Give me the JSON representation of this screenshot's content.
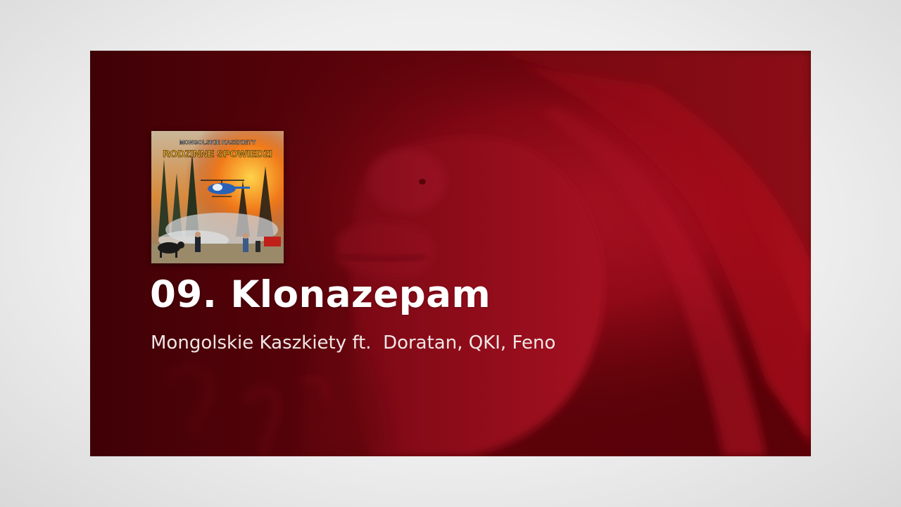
{
  "video": {
    "track_title": "09. Klonazepam",
    "track_artists": "Mongolskie Kaszkiety ft.  Doratan, QKI, Feno"
  },
  "album_cover": {
    "band_name": "MONGOLSKIE KASZKIETY",
    "album_title": "RODZINNE SPOWIEDZI"
  },
  "colors": {
    "page_background": "#efefef",
    "frame_dark_red": "#5a0208",
    "highlight_red": "#d21830",
    "title_text": "#ffffff",
    "subtitle_text": "#f1e6e6"
  },
  "background_image": {
    "subject": "face-in-red-light"
  }
}
